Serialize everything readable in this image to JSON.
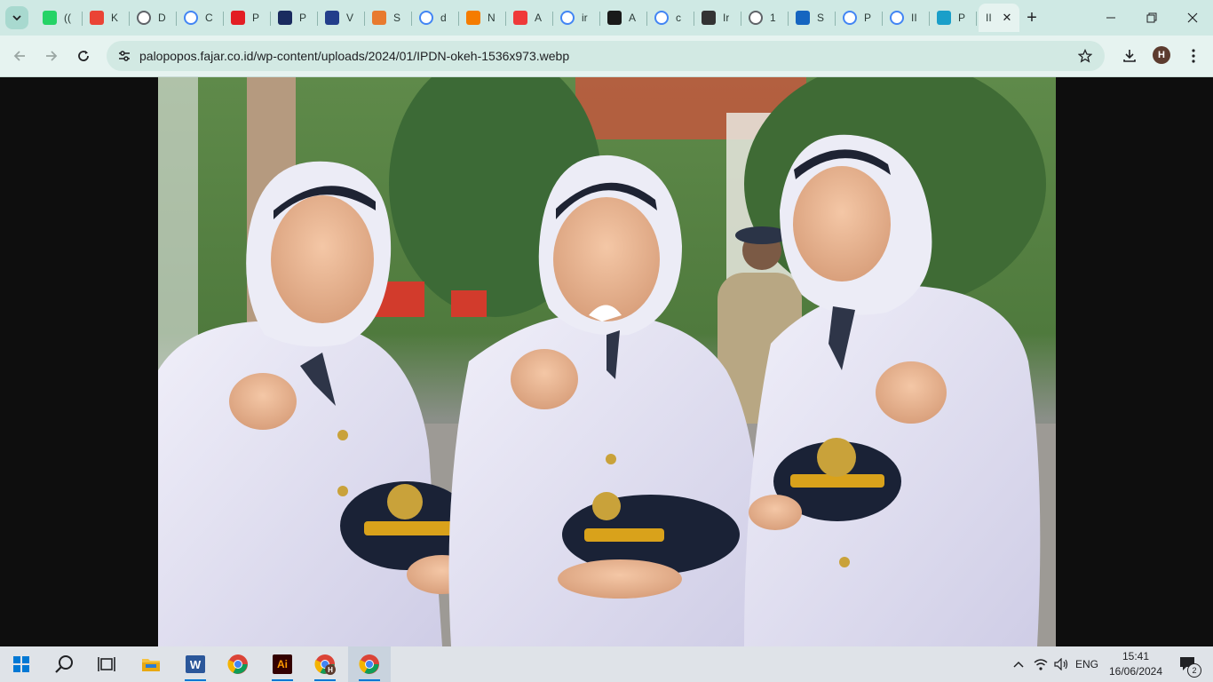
{
  "browser": {
    "tabs": [
      {
        "label": "((",
        "favicon": "whatsapp-icon",
        "color": "#25d366"
      },
      {
        "label": "K",
        "favicon": "gmail-icon",
        "color": "#ea4335"
      },
      {
        "label": "D",
        "favicon": "globe-icon",
        "color": "#5f6368"
      },
      {
        "label": "C",
        "favicon": "google-icon",
        "color": "#4285f4"
      },
      {
        "label": "P",
        "favicon": "m-logo-icon",
        "color": "#e31e24"
      },
      {
        "label": "P",
        "favicon": "k-logo-icon",
        "color": "#1a2b5f"
      },
      {
        "label": "V",
        "favicon": "v-logo-icon",
        "color": "#233e8b"
      },
      {
        "label": "S",
        "favicon": "s-logo-icon",
        "color": "#e87a2e"
      },
      {
        "label": "d",
        "favicon": "google-icon",
        "color": "#4285f4"
      },
      {
        "label": "N",
        "favicon": "v-orange-icon",
        "color": "#f57c00"
      },
      {
        "label": "A",
        "favicon": "vivaldi-icon",
        "color": "#ef3939"
      },
      {
        "label": "ir",
        "favicon": "google-icon",
        "color": "#4285f4"
      },
      {
        "label": "A",
        "favicon": "ko-logo-icon",
        "color": "#1a1a1a"
      },
      {
        "label": "c",
        "favicon": "google-icon",
        "color": "#4285f4"
      },
      {
        "label": "Ir",
        "favicon": "ai-logo-icon",
        "color": "#333333"
      },
      {
        "label": "1",
        "favicon": "globe-icon",
        "color": "#5f6368"
      },
      {
        "label": "S",
        "favicon": "jp-logo-icon",
        "color": "#1565c0"
      },
      {
        "label": "P",
        "favicon": "google-icon",
        "color": "#4285f4"
      },
      {
        "label": "II",
        "favicon": "google-icon",
        "color": "#4285f4"
      },
      {
        "label": "P",
        "favicon": "d-logo-icon",
        "color": "#1a9fc9"
      }
    ],
    "active_tab": {
      "label": "II"
    },
    "url": "palopopos.fajar.co.id/wp-content/uploads/2024/01/IPDN-okeh-1536x973.webp",
    "profile_initial": "H"
  },
  "taskbar": {
    "apps": [
      "start",
      "search",
      "task-view",
      "file-explorer",
      "word",
      "chrome",
      "illustrator",
      "chrome-profile",
      "chrome"
    ],
    "language": "ENG",
    "time": "15:41",
    "date": "16/06/2024",
    "notifications": "2",
    "illustrator_label": "Ai",
    "word_label": "W",
    "chrome_profile_badge": "H"
  },
  "colors": {
    "tabstrip": "#cfe9e4",
    "toolbar": "#e6f3f0",
    "uniform": "#e7e6f6",
    "cap": "#1a2236",
    "gold": "#d9a21b"
  }
}
